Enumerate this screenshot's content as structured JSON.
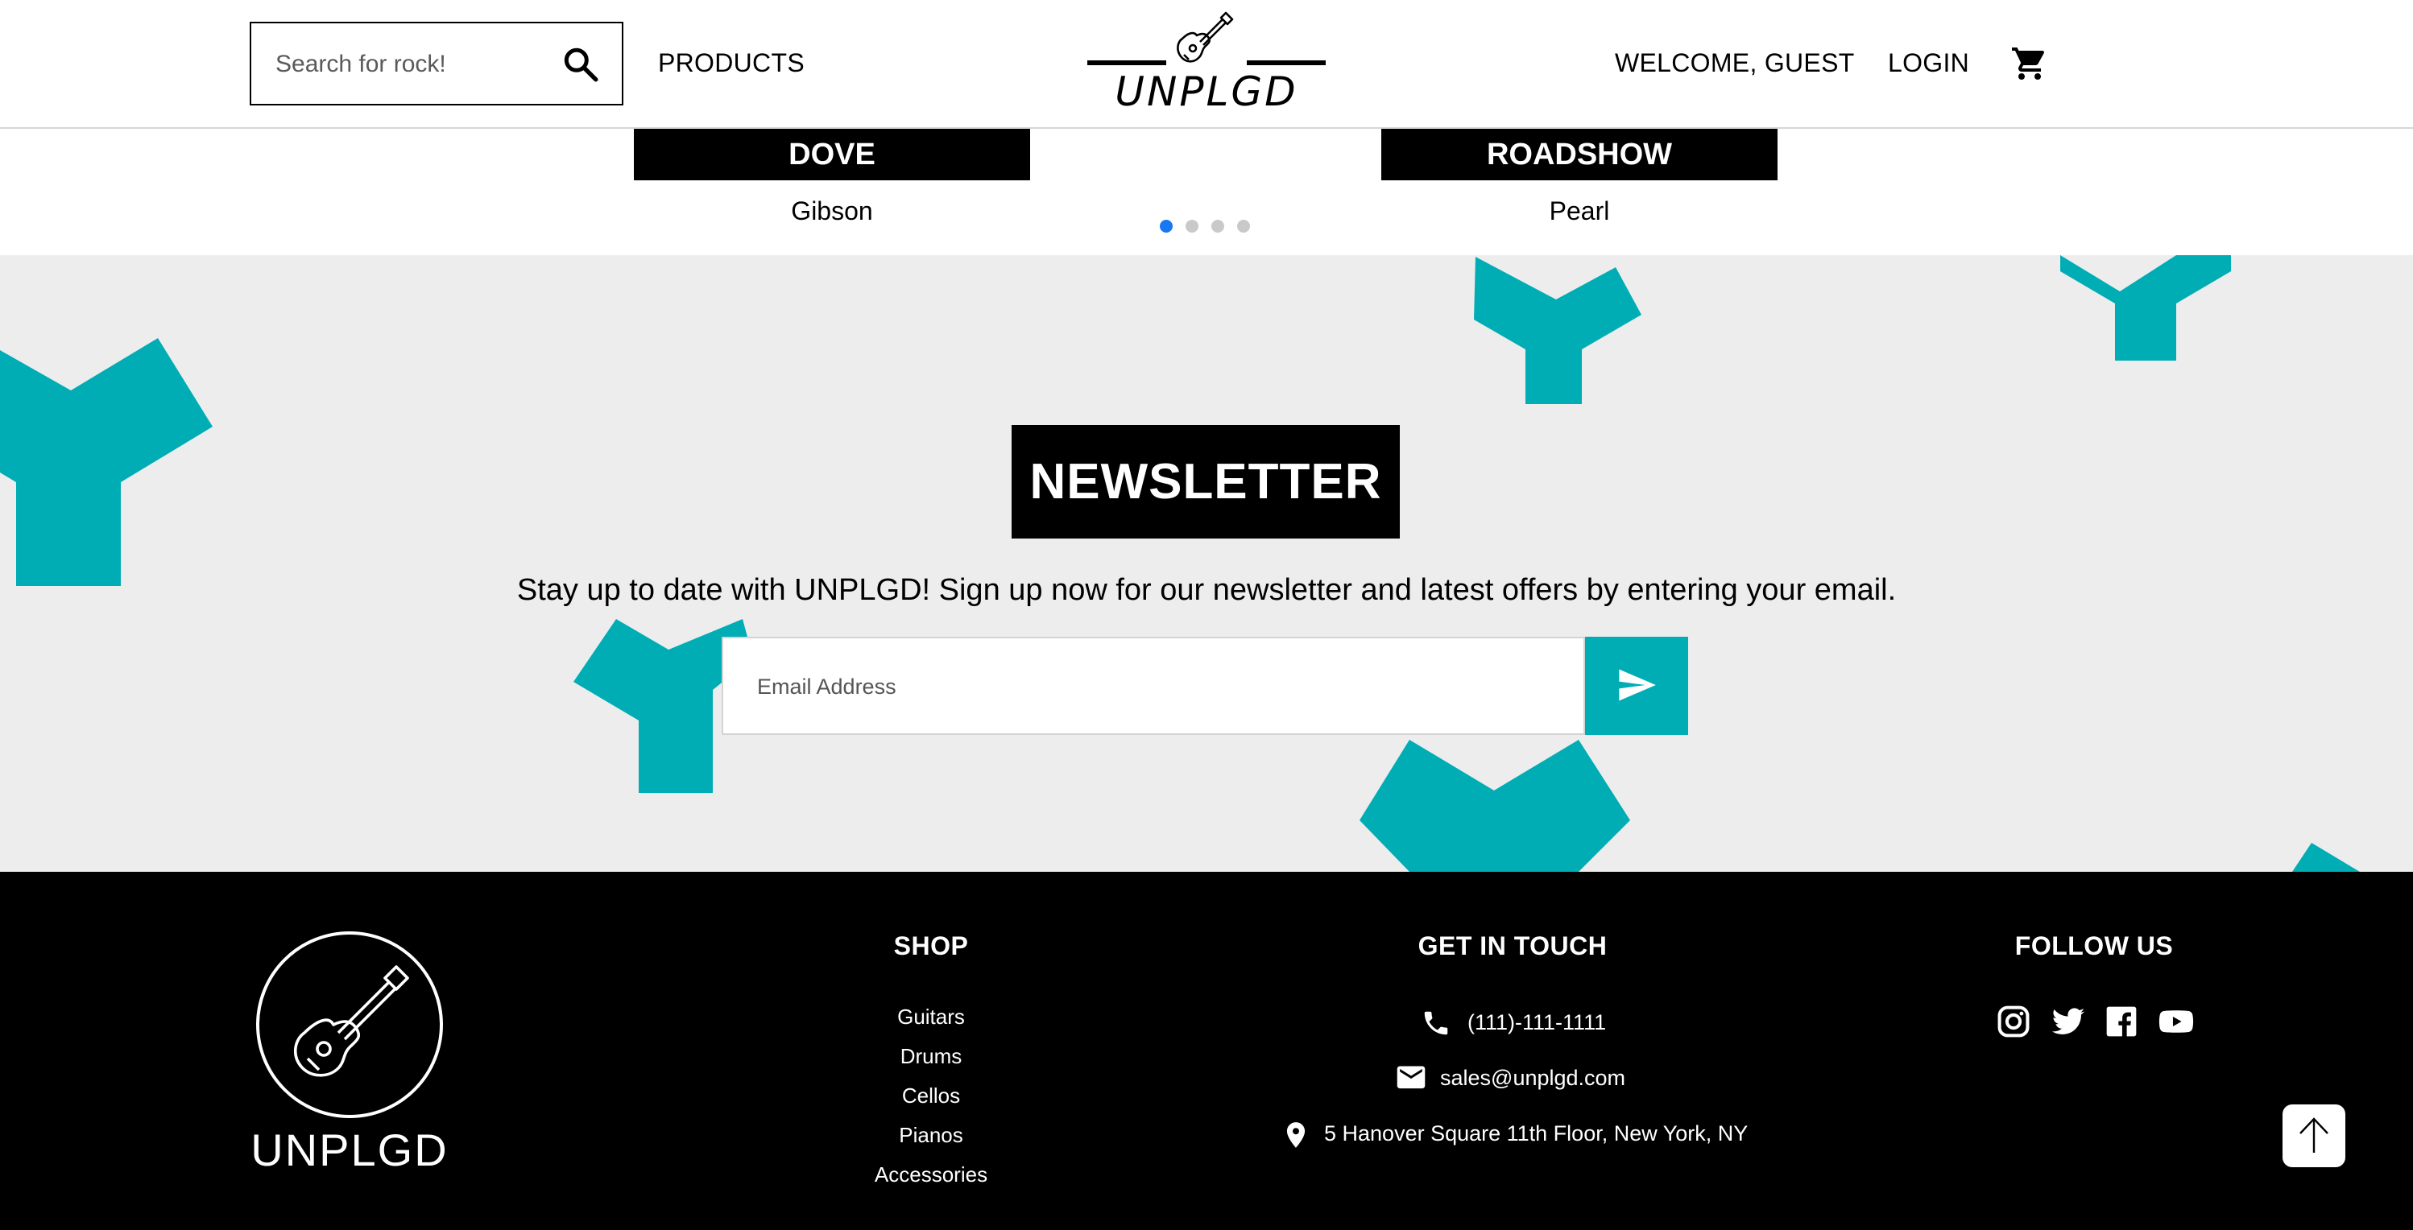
{
  "header": {
    "search": {
      "placeholder": "Search for rock!",
      "value": ""
    },
    "products_label": "PRODUCTS",
    "logo_text": "UNPLGD",
    "welcome_label": "WELCOME, GUEST",
    "login_label": "LOGIN"
  },
  "carousel": {
    "products": [
      {
        "name": "DOVE",
        "brand": "Gibson"
      },
      {
        "name": "ROADSHOW",
        "brand": "Pearl"
      }
    ],
    "dots_total": 4,
    "active_dot": 1,
    "active_color": "#1877f2"
  },
  "newsletter": {
    "title": "NEWSLETTER",
    "text": "Stay up to date with UNPLGD! Sign up now for our newsletter and latest offers by entering your email.",
    "email_placeholder": "Email Address",
    "email_value": "",
    "accent_color": "#00adb5"
  },
  "footer": {
    "logo_text": "UNPLGD",
    "shop": {
      "title": "SHOP",
      "links": [
        "Guitars",
        "Drums",
        "Cellos",
        "Pianos",
        "Accessories"
      ]
    },
    "contact": {
      "title": "GET IN TOUCH",
      "phone": "(111)-111-1111",
      "email": "sales@unplgd.com",
      "address": "5 Hanover Square 11th Floor, New York, NY"
    },
    "follow": {
      "title": "FOLLOW US",
      "icons": [
        "instagram-icon",
        "twitter-icon",
        "facebook-icon",
        "youtube-icon"
      ]
    }
  }
}
